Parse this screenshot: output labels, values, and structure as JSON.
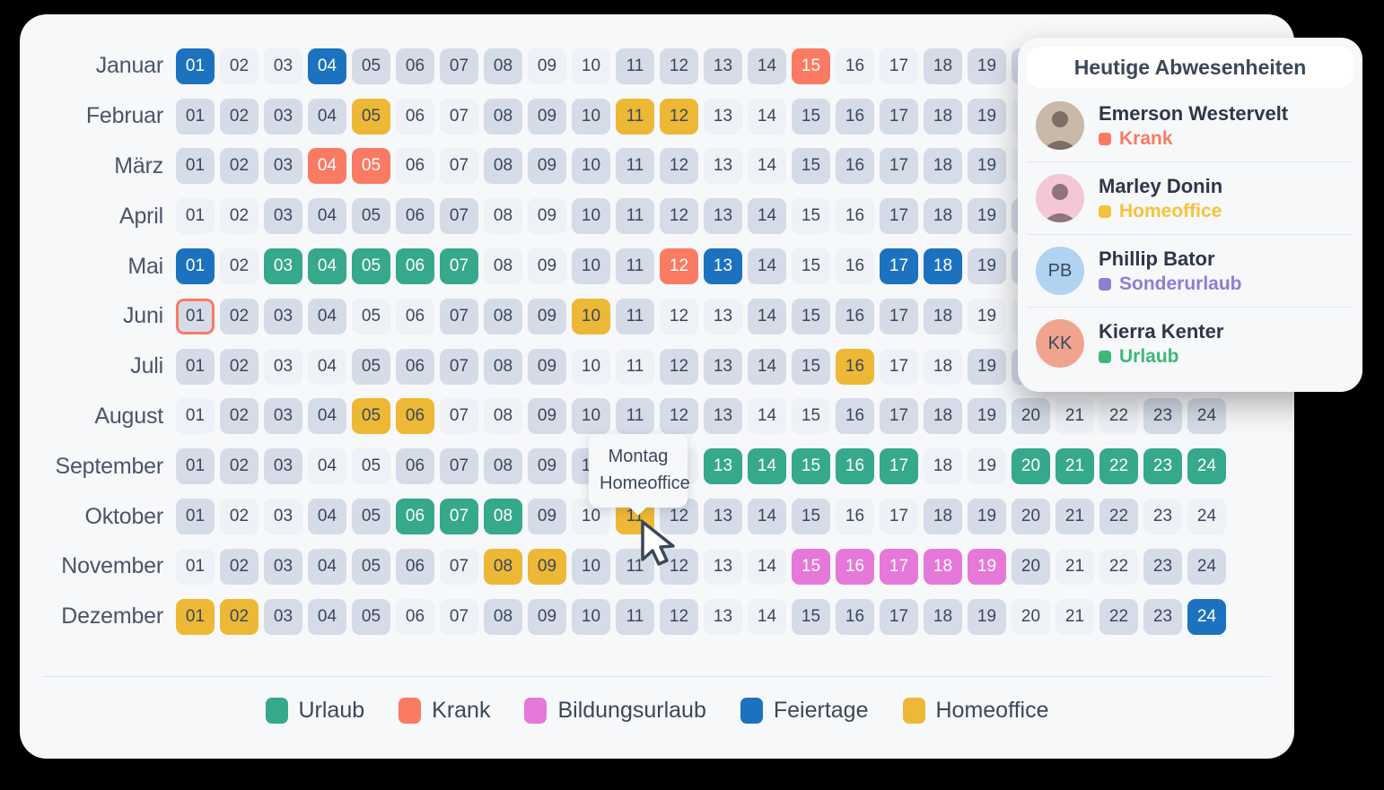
{
  "calendar": {
    "day_columns": [
      "01",
      "02",
      "03",
      "04",
      "05",
      "06",
      "07",
      "08",
      "09",
      "10",
      "11",
      "12",
      "13",
      "14",
      "15",
      "16",
      "17",
      "18",
      "19",
      "20",
      "21",
      "22",
      "23",
      "24"
    ],
    "months": [
      {
        "name": "Januar",
        "types": [
          "feiertage",
          "we",
          "we",
          "feiertage",
          "wk",
          "wk",
          "wk",
          "wk",
          "we",
          "we",
          "wk",
          "wk",
          "wk",
          "wk",
          "krank",
          "we",
          "we",
          "wk",
          "wk",
          "wk",
          "wk",
          "wk",
          "we",
          "we"
        ]
      },
      {
        "name": "Februar",
        "types": [
          "wk",
          "wk",
          "wk",
          "wk",
          "homeoffice",
          "we",
          "we",
          "wk",
          "wk",
          "wk",
          "homeoffice",
          "homeoffice",
          "we",
          "we",
          "wk",
          "wk",
          "wk",
          "wk",
          "wk",
          "we",
          "we",
          "wk",
          "wk",
          "wk"
        ]
      },
      {
        "name": "März",
        "types": [
          "wk",
          "wk",
          "wk",
          "krank",
          "krank",
          "we",
          "we",
          "wk",
          "wk",
          "wk",
          "wk",
          "wk",
          "we",
          "we",
          "wk",
          "wk",
          "wk",
          "wk",
          "wk",
          "we",
          "we",
          "wk",
          "wk",
          "wk"
        ]
      },
      {
        "name": "April",
        "types": [
          "we",
          "we",
          "wk",
          "wk",
          "wk",
          "wk",
          "wk",
          "we",
          "we",
          "wk",
          "wk",
          "wk",
          "wk",
          "wk",
          "we",
          "we",
          "wk",
          "wk",
          "wk",
          "wk",
          "wk",
          "we",
          "we",
          "wk"
        ]
      },
      {
        "name": "Mai",
        "types": [
          "feiertage",
          "we",
          "urlaub",
          "urlaub",
          "urlaub",
          "urlaub",
          "urlaub",
          "we",
          "we",
          "wk",
          "wk",
          "krank",
          "feiertage",
          "wk",
          "we",
          "we",
          "feiertage",
          "feiertage",
          "wk",
          "wk",
          "wk",
          "we",
          "we",
          "wk"
        ]
      },
      {
        "name": "Juni",
        "types": [
          "today",
          "wk",
          "wk",
          "wk",
          "we",
          "we",
          "wk",
          "wk",
          "wk",
          "homeoffice",
          "wk",
          "we",
          "we",
          "wk",
          "wk",
          "wk",
          "wk",
          "wk",
          "we",
          "we",
          "wk",
          "wk",
          "wk",
          "wk"
        ]
      },
      {
        "name": "Juli",
        "types": [
          "wk",
          "wk",
          "we",
          "we",
          "wk",
          "wk",
          "wk",
          "wk",
          "wk",
          "we",
          "we",
          "wk",
          "wk",
          "wk",
          "wk",
          "homeoffice",
          "we",
          "we",
          "wk",
          "wk",
          "wk",
          "wk",
          "wk",
          "we"
        ]
      },
      {
        "name": "August",
        "types": [
          "we",
          "wk",
          "wk",
          "wk",
          "homeoffice",
          "homeoffice",
          "we",
          "we",
          "wk",
          "wk",
          "wk",
          "wk",
          "wk",
          "we",
          "we",
          "wk",
          "wk",
          "wk",
          "wk",
          "wk",
          "we",
          "we",
          "wk",
          "wk"
        ]
      },
      {
        "name": "September",
        "types": [
          "wk",
          "wk",
          "wk",
          "we",
          "we",
          "wk",
          "wk",
          "wk",
          "wk",
          "wk",
          "we",
          "we",
          "urlaub",
          "urlaub",
          "urlaub",
          "urlaub",
          "urlaub",
          "we",
          "we",
          "urlaub",
          "urlaub",
          "urlaub",
          "urlaub",
          "urlaub"
        ]
      },
      {
        "name": "Oktober",
        "types": [
          "wk",
          "we",
          "we",
          "wk",
          "wk",
          "urlaub",
          "urlaub",
          "urlaub",
          "wk",
          "we",
          "homeoffice",
          "wk",
          "wk",
          "wk",
          "wk",
          "we",
          "we",
          "wk",
          "wk",
          "wk",
          "wk",
          "wk",
          "we",
          "we"
        ]
      },
      {
        "name": "November",
        "types": [
          "we",
          "wk",
          "wk",
          "wk",
          "wk",
          "wk",
          "we",
          "homeoffice",
          "homeoffice",
          "wk",
          "wk",
          "wk",
          "we",
          "we",
          "bildung",
          "bildung",
          "bildung",
          "bildung",
          "bildung",
          "wk",
          "we",
          "we",
          "wk",
          "wk"
        ]
      },
      {
        "name": "Dezember",
        "types": [
          "homeoffice",
          "homeoffice",
          "wk",
          "wk",
          "wk",
          "we",
          "we",
          "wk",
          "wk",
          "wk",
          "wk",
          "wk",
          "we",
          "we",
          "wk",
          "wk",
          "wk",
          "wk",
          "wk",
          "we",
          "we",
          "wk",
          "wk",
          "feiertage"
        ]
      }
    ]
  },
  "tooltip": {
    "line1": "Montag",
    "line2": "Homeoffice"
  },
  "legend": {
    "items": [
      {
        "label": "Urlaub",
        "color": "#36A88C"
      },
      {
        "label": "Krank",
        "color": "#FA7A63"
      },
      {
        "label": "Bildungsurlaub",
        "color": "#E578D8"
      },
      {
        "label": "Feiertage",
        "color": "#1C72BE"
      },
      {
        "label": "Homeoffice",
        "color": "#EDB836"
      }
    ]
  },
  "panel": {
    "title": "Heutige Abwesenheiten",
    "absences": [
      {
        "name": "Emerson Westervelt",
        "status": "Krank",
        "status_color": "#FA7A63",
        "avatar_type": "photo",
        "initials": "",
        "avatar_bg": "#C9B9A8"
      },
      {
        "name": "Marley Donin",
        "status": "Homeoffice",
        "status_color": "#F5C23C",
        "avatar_type": "photo",
        "initials": "",
        "avatar_bg": "#F3C6D8"
      },
      {
        "name": "Phillip Bator",
        "status": "Sonderurlaub",
        "status_color": "#8B7FD4",
        "avatar_type": "initials",
        "initials": "PB",
        "avatar_bg": "#AFD3F0"
      },
      {
        "name": "Kierra Kenter",
        "status": "Urlaub",
        "status_color": "#3CB878",
        "avatar_type": "initials",
        "initials": "KK",
        "avatar_bg": "#F0A48E"
      }
    ]
  }
}
